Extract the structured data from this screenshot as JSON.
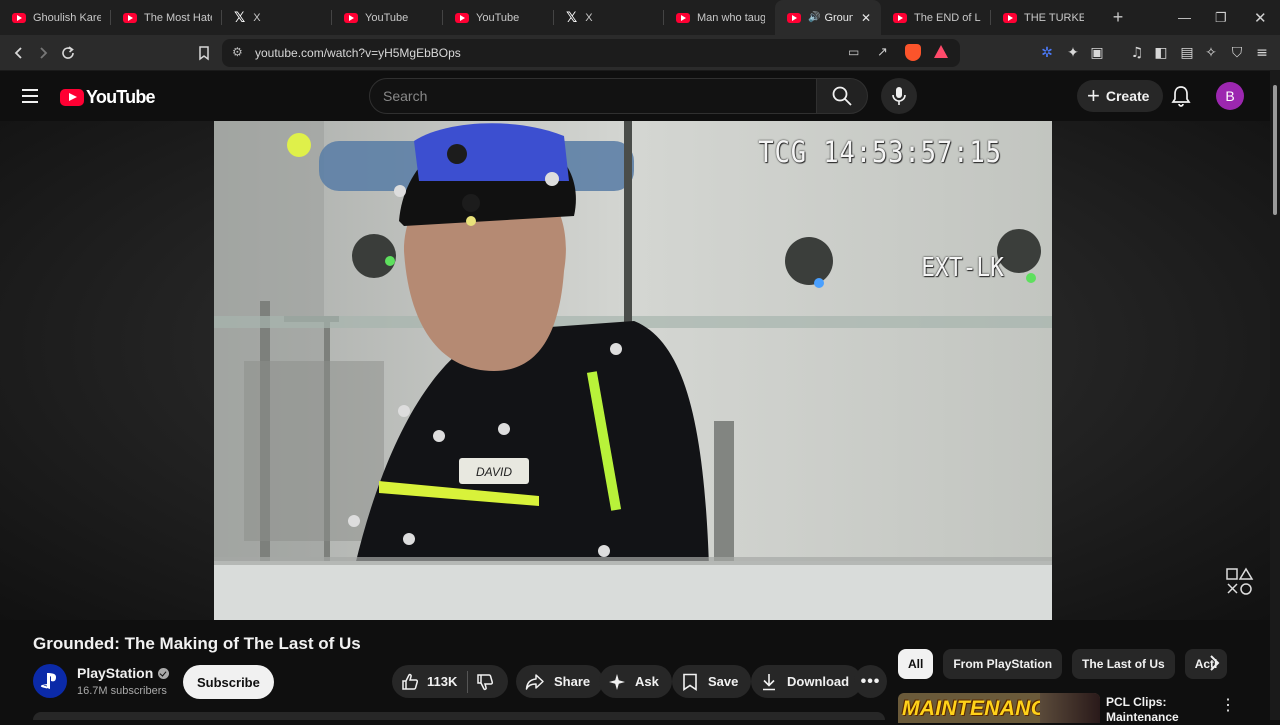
{
  "browser": {
    "tabs": [
      {
        "label": "Ghoulish Karen",
        "icon": "youtube-icon"
      },
      {
        "label": "The Most Hated",
        "icon": "youtube-icon"
      },
      {
        "label": "X",
        "icon": "x-icon"
      },
      {
        "label": "YouTube",
        "icon": "youtube-icon"
      },
      {
        "label": "YouTube",
        "icon": "youtube-icon"
      },
      {
        "label": "X",
        "icon": "x-icon"
      },
      {
        "label": "Man who taugh",
        "icon": "youtube-icon"
      },
      {
        "label": "Groundi",
        "icon": "youtube-icon",
        "active": true
      },
      {
        "label": "The END of Lok",
        "icon": "youtube-icon"
      },
      {
        "label": "THE TURKEY TO",
        "icon": "youtube-icon"
      }
    ],
    "address": "youtube.com/watch?v=yH5MgEbBOps"
  },
  "header": {
    "logo_text": "YouTube",
    "search_placeholder": "Search",
    "create_label": "Create",
    "avatar_letter": "B"
  },
  "video": {
    "timecode": "TCG 14:53:57:15",
    "camera_label": "EXT-LK",
    "badge_text": "DAVID"
  },
  "info": {
    "title": "Grounded: The Making of The Last of Us",
    "channel": "PlayStation",
    "subscribers": "16.7M subscribers",
    "subscribe_label": "Subscribe",
    "likes": "113K",
    "share_label": "Share",
    "ask_label": "Ask",
    "save_label": "Save",
    "download_label": "Download"
  },
  "sidebar": {
    "chips": [
      "All",
      "From PlayStation",
      "The Last of Us",
      "Acti"
    ],
    "recommendation": {
      "thumb_text": "MAINTENANCE",
      "title": "PCL Clips: Maintenance"
    }
  },
  "colors": {
    "brand_red": "#ff0033",
    "background": "#0f0f0f",
    "avatar": "#9c27b0"
  }
}
